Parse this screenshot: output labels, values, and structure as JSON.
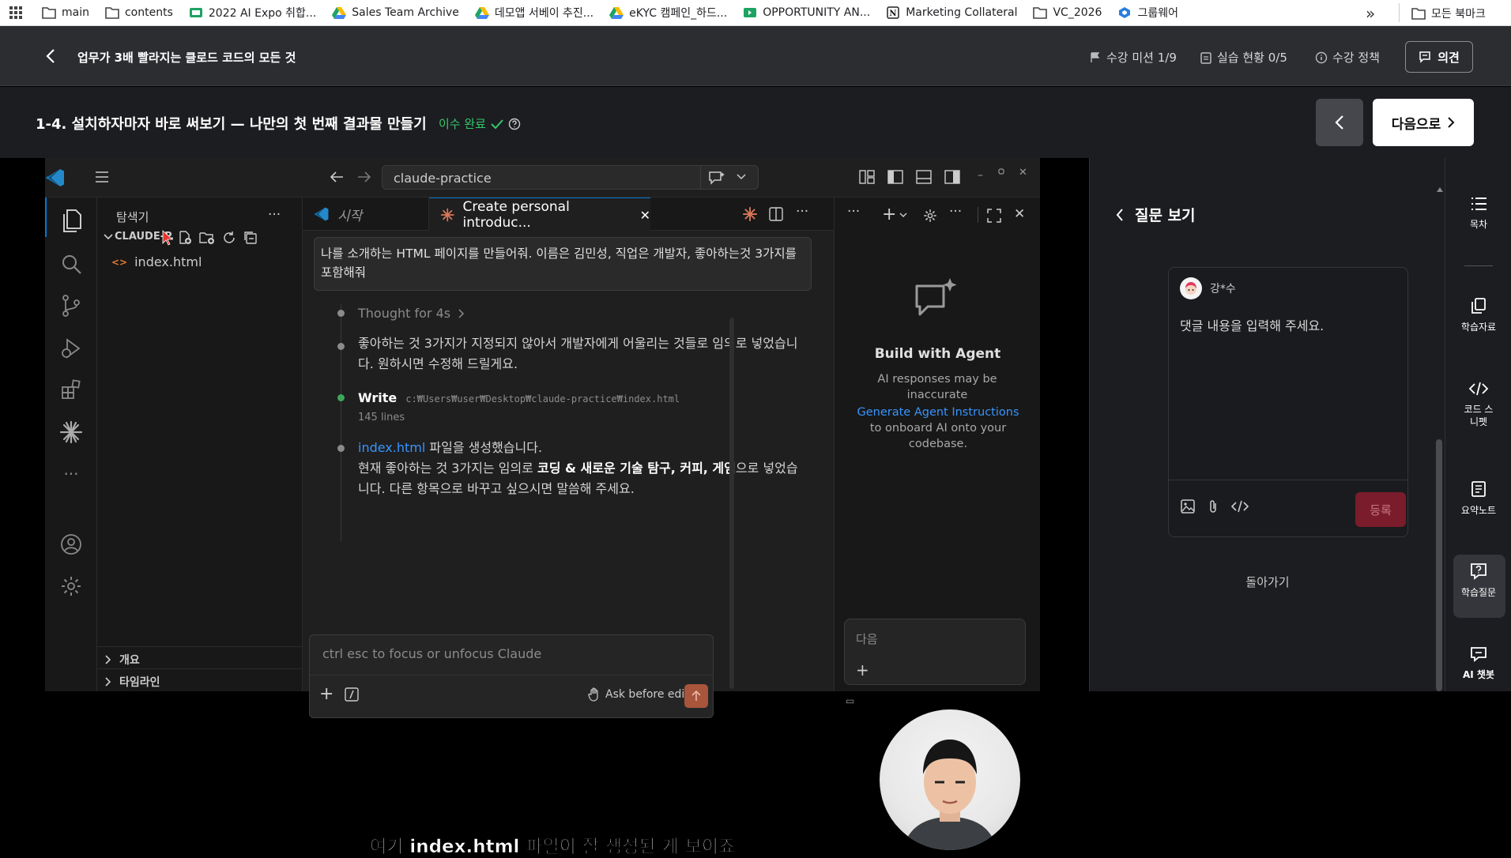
{
  "bookmarks": {
    "items": [
      {
        "label": "main",
        "icon": "folder-icon"
      },
      {
        "label": "contents",
        "icon": "folder-icon"
      },
      {
        "label": "2022 AI Expo 취합...",
        "icon": "sheets-icon"
      },
      {
        "label": "Sales Team Archive",
        "icon": "drive-icon"
      },
      {
        "label": "데모앱 서베이 추진...",
        "icon": "drive-icon"
      },
      {
        "label": "eKYC 캠페인_하드...",
        "icon": "drive-icon"
      },
      {
        "label": "OPPORTUNITY AN...",
        "icon": "sheets-icon"
      },
      {
        "label": "Marketing Collateral",
        "icon": "notion-icon"
      },
      {
        "label": "VC_2026",
        "icon": "folder-icon"
      },
      {
        "label": "그룹웨어",
        "icon": "groupware-icon"
      }
    ],
    "overflow": "»",
    "all_bookmarks": "모든 북마크"
  },
  "course": {
    "title": "업무가 3배 빨라지는 클로드 코드의 모든 것",
    "mission": "수강 미션 1/9",
    "practice": "실습 현황 0/5",
    "policy": "수강 정책",
    "feedback": "의견"
  },
  "lesson": {
    "title": "1-4. 설치하자마자 바로 써보기 — 나만의 첫 번째 결과물 만들기",
    "status": "이수 완료",
    "next": "다음으로"
  },
  "vscode": {
    "search": "claude-practice",
    "explorer_title": "탐색기",
    "folder": "CLAUDE-P...",
    "file": "index.html",
    "outline": "개요",
    "timeline": "타임라인",
    "tabs": [
      {
        "label": "시작"
      },
      {
        "label": "Create personal introduc..."
      }
    ],
    "prompt": "나를 소개하는 HTML 페이지를 만들어줘. 이름은 김민성, 직업은 개발자, 좋아하는것 3가지를 포함해줘",
    "thought": "Thought for 4s",
    "msg1": "좋아하는 것 3가지가 지정되지 않아서 개발자에게 어울리는 것들로 임의로 넣었습니다. 원하시면 수정해 드릴게요.",
    "write_label": "Write",
    "write_path": "c:₩Users₩user₩Desktop₩claude-practice₩index.html",
    "write_lines": "145 lines",
    "msg2_link": "index.html",
    "msg2_rest": " 파일을 생성했습니다.",
    "msg3_pre": "현재 좋아하는 것 3가지는 임의로 ",
    "msg3_bold": "코딩 & 새로운 기술 탐구, 커피, 게임",
    "msg3_post": "으로 넣었습니다. 다른 항목으로 바꾸고 싶으시면 말씀해 주세요.",
    "input_placeholder": "ctrl esc to focus or unfocus Claude",
    "ask_before": "Ask before edits",
    "agent_title": "Build with Agent",
    "agent_desc1": "AI responses may be inaccurate",
    "agent_link": "Generate Agent Instructions",
    "agent_desc2": " to onboard AI onto your codebase.",
    "agent_input": "다음"
  },
  "qa": {
    "back_title": "질문 보기",
    "user": "강*수",
    "placeholder": "댓글 내용을 입력해 주세요.",
    "submit": "등록",
    "return": "돌아가기"
  },
  "sidebar": {
    "items": [
      {
        "label": "목차",
        "icon": "list-icon"
      },
      {
        "label": "학습자료",
        "icon": "copy-icon"
      },
      {
        "label": "코드 스니펫",
        "icon": "code-icon"
      },
      {
        "label": "요약노트",
        "icon": "note-icon"
      },
      {
        "label": "학습질문",
        "icon": "question-icon"
      },
      {
        "label": "AI 챗봇",
        "icon": "chat-icon"
      }
    ]
  },
  "subtitle": "여기 index.html 파일이 잘 생성된 게 보이죠",
  "colors": {
    "accent_green": "#33c76a",
    "claude_orange": "#d97757",
    "vscode_blue": "#3794ff",
    "submit_red": "#7a1c2b"
  }
}
